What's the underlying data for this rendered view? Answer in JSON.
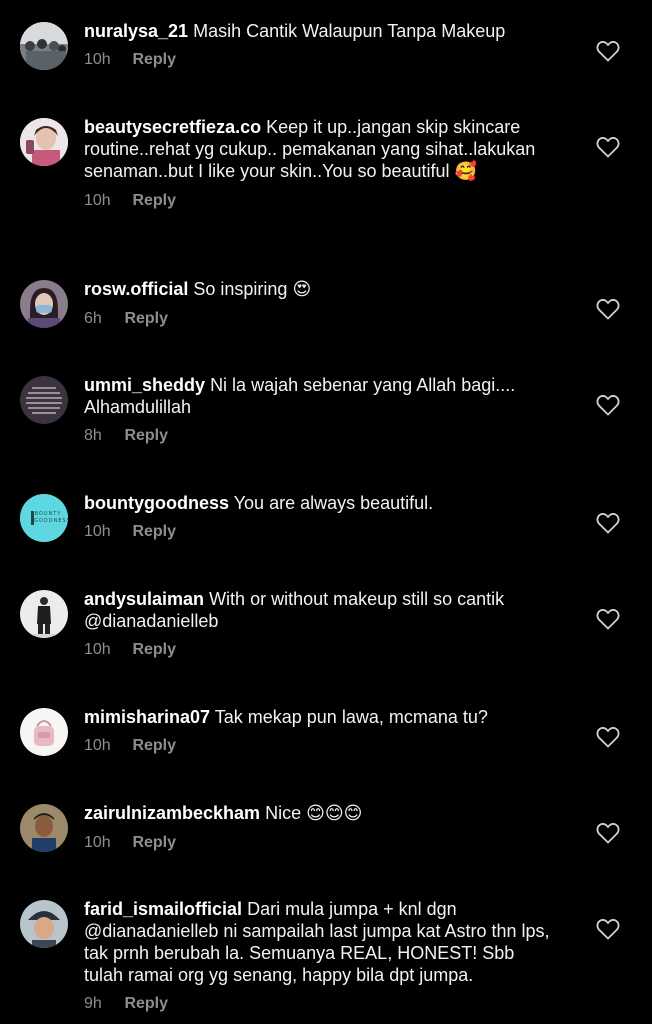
{
  "reply_label": "Reply",
  "comments": [
    {
      "username": "nuralysa_21",
      "text": "Masih Cantik Walaupun Tanpa Makeup",
      "emoji": "",
      "time": "10h",
      "avatar": "crowd-photo"
    },
    {
      "username": "beautysecretfieza.co",
      "text": "Keep it up..jangan skip skincare routine..rehat yg cukup.. pemakanan yang sihat..lakukan senaman..but I like your skin..You so beautiful",
      "emoji": "🥰",
      "time": "10h",
      "avatar": "woman-photo"
    },
    {
      "username": "rosw.official",
      "text": "So inspiring",
      "emoji": "😍",
      "time": "6h",
      "avatar": "masked-woman-photo"
    },
    {
      "username": "ummi_sheddy",
      "text": "Ni la wajah sebenar yang Allah bagi.... Alhamdulillah",
      "emoji": "",
      "time": "8h",
      "avatar": "quote-text-image"
    },
    {
      "username": "bountygoodness",
      "text": "You are always beautiful.",
      "emoji": "",
      "time": "10h",
      "avatar": "bounty-goodness-logo",
      "avatar_logo_text": "BOUNTY GOODNESS"
    },
    {
      "username": "andysulaiman",
      "text": "With or without makeup still so cantik @dianadanielleb",
      "emoji": "",
      "time": "10h",
      "avatar": "man-standing-photo"
    },
    {
      "username": "mimisharina07",
      "text": "Tak mekap pun lawa, mcmana tu?",
      "emoji": "",
      "time": "10h",
      "avatar": "pink-bag-photo"
    },
    {
      "username": "zairulnizambeckham",
      "text": "Nice",
      "emoji": "😊😊😊",
      "time": "10h",
      "avatar": "man-cap-photo"
    },
    {
      "username": "farid_ismailofficial",
      "text": "Dari mula jumpa + knl dgn @dianadanielleb ni sampailah last jumpa kat Astro thn lps, tak prnh berubah la. Semuanya REAL, HONEST! Sbb tulah ramai org yg senang, happy bila dpt jumpa.",
      "emoji": "",
      "time": "9h",
      "avatar": "man-cap-photo-2"
    }
  ],
  "colors": {
    "background": "#000000",
    "text": "#f2f2f2",
    "meta": "#8e8e8e",
    "heart": "#cfcfcf",
    "bounty_avatar": "#5ed8e0"
  }
}
